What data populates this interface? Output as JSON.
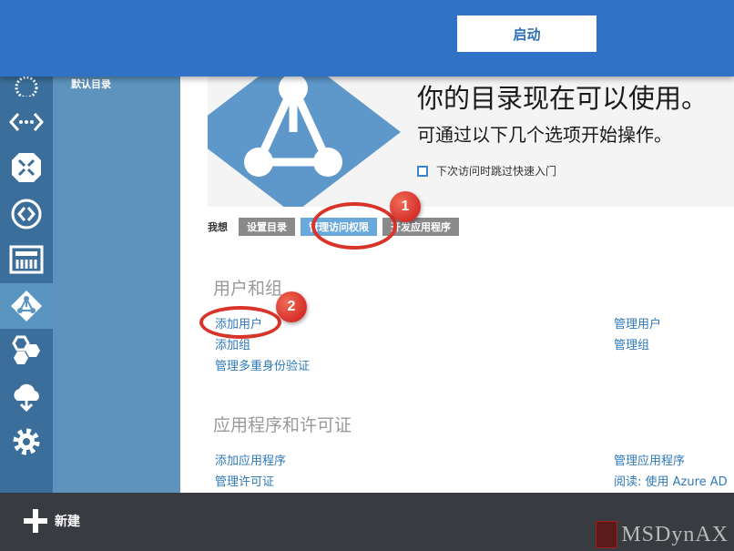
{
  "banner": {
    "start_button": "启动"
  },
  "nav": {
    "directory_label": "默认目录"
  },
  "rail": {
    "items": [
      "web-icon",
      "code-icon",
      "resize-icon",
      "network-icon",
      "dashboard-icon",
      "directory-icon",
      "hexagons-icon",
      "cloud-icon",
      "settings-icon"
    ],
    "active": "directory-icon"
  },
  "hero": {
    "title": "你的目录现在可以使用。",
    "subtitle": "可通过以下几个选项开始操作。",
    "skip_label": "下次访问时跳过快速入门"
  },
  "tabs": {
    "lead": "我想",
    "items": [
      "设置目录",
      "管理访问权限",
      "开发应用程序"
    ],
    "selected": "管理访问权限"
  },
  "users": {
    "title": "用户和组",
    "links": [
      "添加用户",
      "添加组",
      "管理多重身份验证"
    ],
    "right_links": [
      "管理用户",
      "管理组"
    ]
  },
  "apps": {
    "title": "应用程序和许可证",
    "links": [
      "添加应用程序",
      "管理许可证"
    ],
    "right_links": [
      "管理应用程序",
      "阅读: 使用 Azure AD"
    ]
  },
  "annotations": [
    "1",
    "2"
  ],
  "bottom": {
    "new_label": "新建"
  },
  "watermark": "MSDynAX",
  "colors": {
    "banner": "#2f72c6",
    "rail": "#3b6e9a",
    "nav": "#5d93bd",
    "annotation": "#d9342a",
    "link": "#2f79b8"
  }
}
